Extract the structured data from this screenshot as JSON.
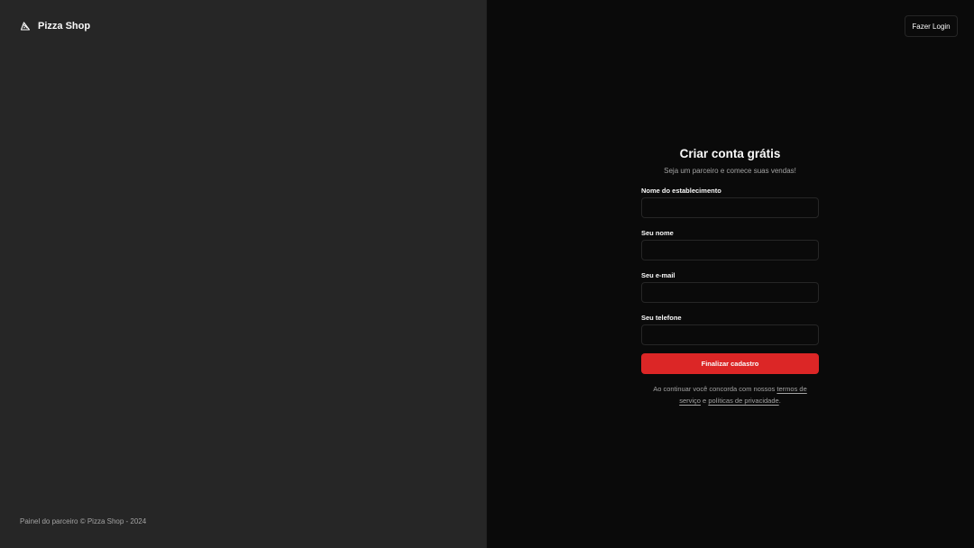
{
  "brand": {
    "name": "Pizza Shop",
    "icon": "pizza-slice-icon"
  },
  "left_footer": "Painel do parceiro © Pizza Shop - 2024",
  "header": {
    "login_label": "Fazer Login"
  },
  "form": {
    "title": "Criar conta grátis",
    "subtitle": "Seja um parceiro e comece suas vendas!",
    "fields": [
      {
        "label": "Nome do establecimento",
        "value": "",
        "placeholder": ""
      },
      {
        "label": "Seu nome",
        "value": "",
        "placeholder": ""
      },
      {
        "label": "Seu e-mail",
        "value": "",
        "placeholder": ""
      },
      {
        "label": "Seu telefone",
        "value": "",
        "placeholder": ""
      }
    ],
    "submit_label": "Finalizar cadastro",
    "terms": {
      "prefix": "Ao continuar você concorda com nossos ",
      "terms_link": "termos de serviço",
      "middle": " e ",
      "privacy_link": "políticas de privacidade",
      "suffix": "."
    }
  },
  "colors": {
    "left_panel": "#262626",
    "right_panel": "#0a0a0a",
    "primary": "#dc2626",
    "muted_text": "#a3a3a3"
  }
}
